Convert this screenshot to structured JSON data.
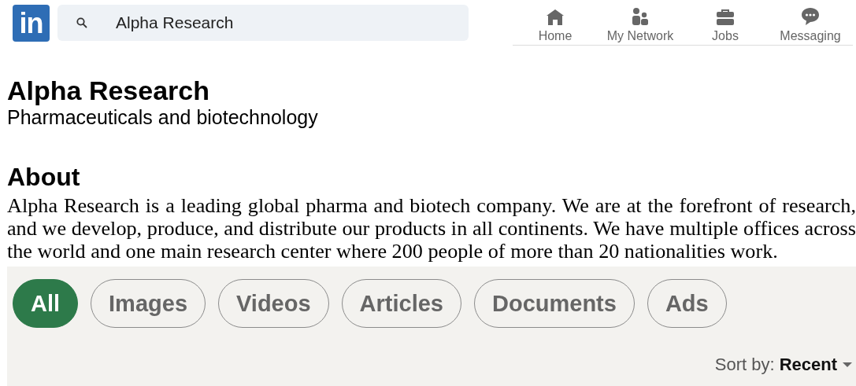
{
  "header": {
    "logo": "in",
    "search": {
      "value": "Alpha Research"
    },
    "nav": [
      {
        "label": "Home",
        "kind": "home"
      },
      {
        "label": "My Network",
        "kind": "network"
      },
      {
        "label": "Jobs",
        "kind": "jobs"
      },
      {
        "label": "Messaging",
        "kind": "messaging"
      }
    ]
  },
  "company": {
    "name": "Alpha Research",
    "industry": "Pharmaceuticals and biotechnology"
  },
  "about": {
    "heading": "About",
    "text": "Alpha Research is a leading global pharma and biotech company. We are at the forefront of research, and we develop, produce, and distribute our products in all continents. We have multiple offices across the world and one main research center where 200 people of more than 20 nationalities work."
  },
  "filters": [
    {
      "label": "All",
      "selected": true
    },
    {
      "label": "Images",
      "selected": false
    },
    {
      "label": "Videos",
      "selected": false
    },
    {
      "label": "Articles",
      "selected": false
    },
    {
      "label": "Documents",
      "selected": false
    },
    {
      "label": "Ads",
      "selected": false
    }
  ],
  "sort": "Sort by: **Recent**"
}
